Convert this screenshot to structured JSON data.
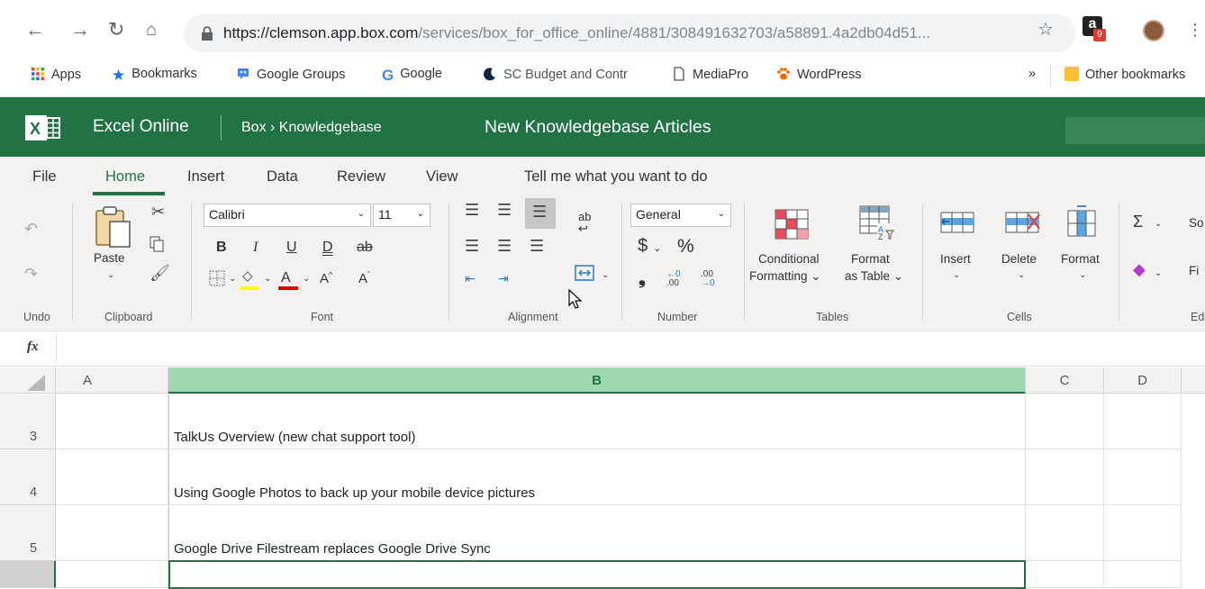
{
  "browser": {
    "url_host": "https://clemson.app.box.com",
    "url_path": "/services/box_for_office_online/4881/308491632703/a58891.4a2db04d51...",
    "extension_badge": "9",
    "bookmarks": [
      {
        "label": "Apps",
        "icon": "apps-grid-icon"
      },
      {
        "label": "Bookmarks",
        "icon": "star-icon"
      },
      {
        "label": "Google Groups",
        "icon": "google-groups-icon"
      },
      {
        "label": "Google",
        "icon": "google-icon"
      },
      {
        "label": "SC Budget and Contr",
        "icon": "moon-icon"
      },
      {
        "label": "MediaPro",
        "icon": "page-icon"
      },
      {
        "label": "WordPress",
        "icon": "paw-icon"
      }
    ],
    "overflow": "»",
    "other_bookmarks": "Other bookmarks"
  },
  "app": {
    "name": "Excel Online",
    "breadcrumb": "Box › Knowledgebase",
    "doc_title": "New Knowledgebase Articles",
    "brand_color": "#217346"
  },
  "tabs": [
    "File",
    "Home",
    "Insert",
    "Data",
    "Review",
    "View"
  ],
  "active_tab": "Home",
  "tell_me": "Tell me what you want to do",
  "ribbon": {
    "groups": {
      "undo": "Undo",
      "clipboard": "Clipboard",
      "font": "Font",
      "alignment": "Alignment",
      "number": "Number",
      "tables": "Tables",
      "cells": "Cells",
      "editing": "Ed"
    },
    "paste": "Paste",
    "font_name": "Calibri",
    "font_size": "11",
    "number_format": "General",
    "currency": "$",
    "percent": "%",
    "comma": "❟",
    "increase_decimal": "←0\n.00",
    "decrease_decimal": ".00\n→0",
    "cond_format_1": "Conditional",
    "cond_format_2": "Formatting ⌄",
    "fmt_table_1": "Format",
    "fmt_table_2": "as Table ⌄",
    "insert": "Insert",
    "delete": "Delete",
    "format": "Format",
    "sum_label": "So",
    "clear_label": "Fi",
    "bold": "B",
    "italic": "I",
    "underline": "U",
    "double_underline": "D",
    "strike": "ab",
    "grow": "A",
    "shrink": "A"
  },
  "formula_bar": {
    "fx": "fx",
    "value": ""
  },
  "grid": {
    "columns": [
      "A",
      "B",
      "C",
      "D"
    ],
    "selected_column": "B",
    "rows": [
      {
        "num": "3",
        "b": "TalkUs Overview (new chat support tool)"
      },
      {
        "num": "4",
        "b": "Using Google Photos to back up your mobile device pictures"
      },
      {
        "num": "5",
        "b": "Google Drive Filestream replaces Google Drive Sync"
      },
      {
        "num": "",
        "b": ""
      }
    ]
  }
}
